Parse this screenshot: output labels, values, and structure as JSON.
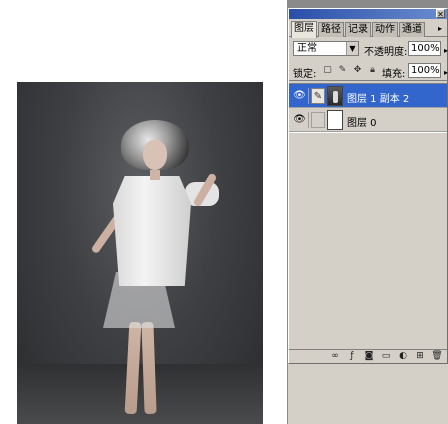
{
  "layers_panel": {
    "tabs": [
      {
        "label": "图层"
      },
      {
        "label": "路径"
      },
      {
        "label": "记录"
      },
      {
        "label": "动作"
      },
      {
        "label": "通道"
      }
    ],
    "blend_mode": "正常",
    "opacity_label": "不透明度:",
    "opacity_value": "100%",
    "lock_label": "锁定:",
    "fill_label": "填充:",
    "fill_value": "100%",
    "layers": [
      {
        "name": "图层 1 副本 2",
        "selected": true
      },
      {
        "name": "图层 0",
        "selected": false
      }
    ]
  },
  "colors": {
    "selected_layer": "#3366cc",
    "panel_bg": "#d4d0c8",
    "title_bar": "#2a4fa8"
  }
}
